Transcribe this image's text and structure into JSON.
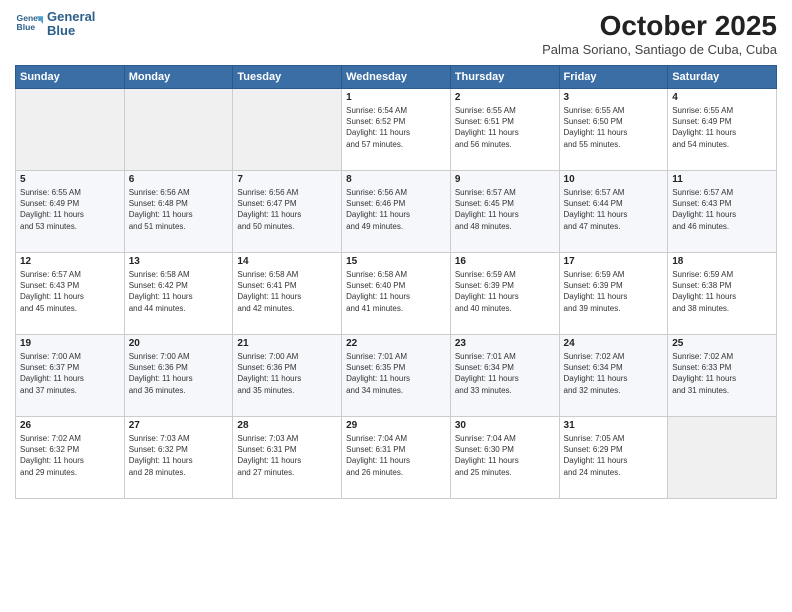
{
  "logo": {
    "line1": "General",
    "line2": "Blue"
  },
  "title": "October 2025",
  "subtitle": "Palma Soriano, Santiago de Cuba, Cuba",
  "days_of_week": [
    "Sunday",
    "Monday",
    "Tuesday",
    "Wednesday",
    "Thursday",
    "Friday",
    "Saturday"
  ],
  "weeks": [
    [
      {
        "day": "",
        "info": ""
      },
      {
        "day": "",
        "info": ""
      },
      {
        "day": "",
        "info": ""
      },
      {
        "day": "1",
        "info": "Sunrise: 6:54 AM\nSunset: 6:52 PM\nDaylight: 11 hours\nand 57 minutes."
      },
      {
        "day": "2",
        "info": "Sunrise: 6:55 AM\nSunset: 6:51 PM\nDaylight: 11 hours\nand 56 minutes."
      },
      {
        "day": "3",
        "info": "Sunrise: 6:55 AM\nSunset: 6:50 PM\nDaylight: 11 hours\nand 55 minutes."
      },
      {
        "day": "4",
        "info": "Sunrise: 6:55 AM\nSunset: 6:49 PM\nDaylight: 11 hours\nand 54 minutes."
      }
    ],
    [
      {
        "day": "5",
        "info": "Sunrise: 6:55 AM\nSunset: 6:49 PM\nDaylight: 11 hours\nand 53 minutes."
      },
      {
        "day": "6",
        "info": "Sunrise: 6:56 AM\nSunset: 6:48 PM\nDaylight: 11 hours\nand 51 minutes."
      },
      {
        "day": "7",
        "info": "Sunrise: 6:56 AM\nSunset: 6:47 PM\nDaylight: 11 hours\nand 50 minutes."
      },
      {
        "day": "8",
        "info": "Sunrise: 6:56 AM\nSunset: 6:46 PM\nDaylight: 11 hours\nand 49 minutes."
      },
      {
        "day": "9",
        "info": "Sunrise: 6:57 AM\nSunset: 6:45 PM\nDaylight: 11 hours\nand 48 minutes."
      },
      {
        "day": "10",
        "info": "Sunrise: 6:57 AM\nSunset: 6:44 PM\nDaylight: 11 hours\nand 47 minutes."
      },
      {
        "day": "11",
        "info": "Sunrise: 6:57 AM\nSunset: 6:43 PM\nDaylight: 11 hours\nand 46 minutes."
      }
    ],
    [
      {
        "day": "12",
        "info": "Sunrise: 6:57 AM\nSunset: 6:43 PM\nDaylight: 11 hours\nand 45 minutes."
      },
      {
        "day": "13",
        "info": "Sunrise: 6:58 AM\nSunset: 6:42 PM\nDaylight: 11 hours\nand 44 minutes."
      },
      {
        "day": "14",
        "info": "Sunrise: 6:58 AM\nSunset: 6:41 PM\nDaylight: 11 hours\nand 42 minutes."
      },
      {
        "day": "15",
        "info": "Sunrise: 6:58 AM\nSunset: 6:40 PM\nDaylight: 11 hours\nand 41 minutes."
      },
      {
        "day": "16",
        "info": "Sunrise: 6:59 AM\nSunset: 6:39 PM\nDaylight: 11 hours\nand 40 minutes."
      },
      {
        "day": "17",
        "info": "Sunrise: 6:59 AM\nSunset: 6:39 PM\nDaylight: 11 hours\nand 39 minutes."
      },
      {
        "day": "18",
        "info": "Sunrise: 6:59 AM\nSunset: 6:38 PM\nDaylight: 11 hours\nand 38 minutes."
      }
    ],
    [
      {
        "day": "19",
        "info": "Sunrise: 7:00 AM\nSunset: 6:37 PM\nDaylight: 11 hours\nand 37 minutes."
      },
      {
        "day": "20",
        "info": "Sunrise: 7:00 AM\nSunset: 6:36 PM\nDaylight: 11 hours\nand 36 minutes."
      },
      {
        "day": "21",
        "info": "Sunrise: 7:00 AM\nSunset: 6:36 PM\nDaylight: 11 hours\nand 35 minutes."
      },
      {
        "day": "22",
        "info": "Sunrise: 7:01 AM\nSunset: 6:35 PM\nDaylight: 11 hours\nand 34 minutes."
      },
      {
        "day": "23",
        "info": "Sunrise: 7:01 AM\nSunset: 6:34 PM\nDaylight: 11 hours\nand 33 minutes."
      },
      {
        "day": "24",
        "info": "Sunrise: 7:02 AM\nSunset: 6:34 PM\nDaylight: 11 hours\nand 32 minutes."
      },
      {
        "day": "25",
        "info": "Sunrise: 7:02 AM\nSunset: 6:33 PM\nDaylight: 11 hours\nand 31 minutes."
      }
    ],
    [
      {
        "day": "26",
        "info": "Sunrise: 7:02 AM\nSunset: 6:32 PM\nDaylight: 11 hours\nand 29 minutes."
      },
      {
        "day": "27",
        "info": "Sunrise: 7:03 AM\nSunset: 6:32 PM\nDaylight: 11 hours\nand 28 minutes."
      },
      {
        "day": "28",
        "info": "Sunrise: 7:03 AM\nSunset: 6:31 PM\nDaylight: 11 hours\nand 27 minutes."
      },
      {
        "day": "29",
        "info": "Sunrise: 7:04 AM\nSunset: 6:31 PM\nDaylight: 11 hours\nand 26 minutes."
      },
      {
        "day": "30",
        "info": "Sunrise: 7:04 AM\nSunset: 6:30 PM\nDaylight: 11 hours\nand 25 minutes."
      },
      {
        "day": "31",
        "info": "Sunrise: 7:05 AM\nSunset: 6:29 PM\nDaylight: 11 hours\nand 24 minutes."
      },
      {
        "day": "",
        "info": ""
      }
    ]
  ]
}
